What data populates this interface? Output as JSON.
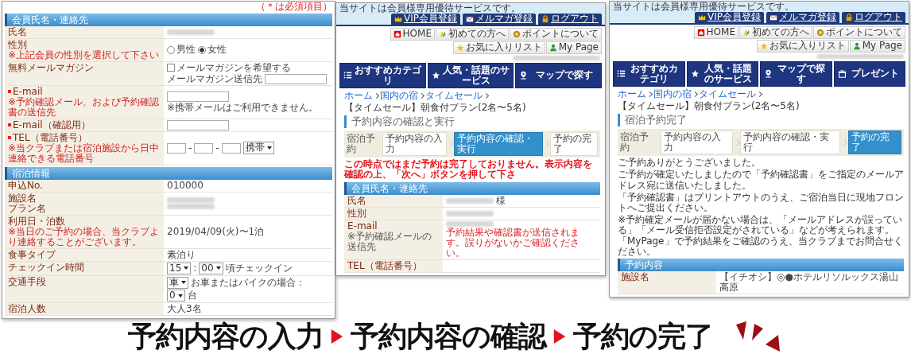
{
  "form_window": {
    "required_note": "（＊は必須項目）",
    "sections": [
      {
        "title": "会員氏名・連絡先",
        "rows": [
          {
            "labels": [
              "氏名"
            ],
            "required": false,
            "notes": [],
            "lines": [
              [
                {
                  "kind": "blur"
                }
              ]
            ]
          },
          {
            "labels": [
              "性別"
            ],
            "required": false,
            "notes": [
              "※上記会員の性別を選択して下さい"
            ],
            "lines": [
              [
                {
                  "kind": "radio",
                  "label": "男性",
                  "selected": false
                },
                {
                  "kind": "radio",
                  "label": "女性",
                  "selected": true
                }
              ]
            ]
          },
          {
            "labels": [
              "無料メールマガジン"
            ],
            "required": false,
            "notes": [],
            "lines": [
              [
                {
                  "kind": "checkbox",
                  "label": "メールマガジンを希望する",
                  "checked": false
                }
              ],
              [
                {
                  "kind": "hint",
                  "value": "メールマガジン送信先"
                },
                {
                  "kind": "field"
                }
              ]
            ]
          },
          {
            "labels": [
              "E-mail"
            ],
            "required": true,
            "notes": [
              "※予約確認メール、および予約確認書の送信先"
            ],
            "lines": [
              [
                {
                  "kind": "field"
                }
              ],
              [
                {
                  "kind": "hint",
                  "value": "※携帯メールはご利用できません。"
                }
              ]
            ]
          },
          {
            "labels": [
              "E-mail（確認用）"
            ],
            "required": true,
            "notes": [],
            "lines": [
              [
                {
                  "kind": "field"
                }
              ]
            ]
          },
          {
            "labels": [
              "TEL（電話番号）"
            ],
            "required": true,
            "notes": [
              "※当クラブまたは宿泊施設から日中連絡できる電話番号"
            ],
            "lines": [
              [
                {
                  "kind": "smallfield"
                },
                {
                  "kind": "text",
                  "value": "-"
                },
                {
                  "kind": "smallfield"
                },
                {
                  "kind": "text",
                  "value": "-"
                },
                {
                  "kind": "smallfield"
                },
                {
                  "kind": "select",
                  "value": "携帯"
                }
              ]
            ]
          }
        ]
      },
      {
        "title": "宿泊情報",
        "rows": [
          {
            "labels": [
              "申込No."
            ],
            "required": false,
            "notes": [],
            "lines": [
              [
                {
                  "kind": "text",
                  "value": "010000"
                }
              ]
            ]
          },
          {
            "labels": [
              "施設名",
              "プラン名"
            ],
            "required": false,
            "notes": [],
            "lines": [
              [
                {
                  "kind": "blur"
                }
              ],
              [
                {
                  "kind": "blur"
                }
              ]
            ]
          },
          {
            "labels": [
              "利用日・泊数"
            ],
            "required": false,
            "notes": [
              "※当日のご予約の場合、当クラブより連絡することがございます。"
            ],
            "lines": [
              [
                {
                  "kind": "text",
                  "value": "2019/04/09(火)〜1泊"
                }
              ]
            ]
          },
          {
            "labels": [
              "食事タイプ"
            ],
            "required": false,
            "notes": [],
            "lines": [
              [
                {
                  "kind": "text",
                  "value": "素泊り"
                }
              ]
            ]
          },
          {
            "labels": [
              "チェックイン時間"
            ],
            "required": false,
            "notes": [],
            "lines": [
              [
                {
                  "kind": "select",
                  "value": "15"
                },
                {
                  "kind": "text",
                  "value": ":"
                },
                {
                  "kind": "select",
                  "value": "00"
                },
                {
                  "kind": "text",
                  "value": "頃チェックイン"
                }
              ]
            ]
          },
          {
            "labels": [
              "交通手段"
            ],
            "required": false,
            "notes": [],
            "lines": [
              [
                {
                  "kind": "select",
                  "value": "車"
                },
                {
                  "kind": "text",
                  "value": "お車またはバイクの場合："
                }
              ],
              [
                {
                  "kind": "select",
                  "value": "0"
                },
                {
                  "kind": "text",
                  "value": "台"
                }
              ]
            ]
          },
          {
            "labels": [
              "宿泊人数"
            ],
            "required": false,
            "notes": [],
            "lines": [
              [
                {
                  "kind": "text",
                  "value": "大人3名"
                }
              ]
            ]
          }
        ]
      }
    ]
  },
  "site_windows": [
    {
      "notice_text": "当サイトは会員様専用優待サービスです。",
      "member_tabs": [
        "VIP会員登録",
        "メルマガ登録",
        "ログアウト"
      ],
      "links": [
        "HOME",
        "初めての方へ",
        "ポイントについて",
        "お気に入りリスト",
        "My Page"
      ],
      "nav": [
        "おすすめカテゴリ",
        "人気・話題のサービス",
        "マップで探す"
      ],
      "breadcrumb": [
        {
          "label": "ホーム",
          "link": true
        },
        {
          "label": "国内の宿",
          "link": true
        },
        {
          "label": "タイムセール",
          "link": true
        },
        {
          "label": "【タイムセール】朝食付プラン(2名〜5名)",
          "link": false
        }
      ],
      "page_title": "予約内容の確認と実行",
      "steps_label": "宿泊予約",
      "steps": [
        {
          "label": "予約内容の入力",
          "selected": false
        },
        {
          "label": "予約内容の確認・実行",
          "selected": true
        },
        {
          "label": "予約の完了",
          "selected": false
        }
      ],
      "warning": "この時点ではまだ予約は完了しておりません。表示内容を確認の上、「次へ」ボタンを押して下さ",
      "sections": [
        {
          "title": "会員氏名・連絡先",
          "rows": [
            {
              "labels": [
                "氏名"
              ],
              "notes": [],
              "lines": [
                [
                  {
                    "kind": "blur"
                  },
                  {
                    "kind": "text",
                    "value": "様"
                  }
                ]
              ]
            },
            {
              "labels": [
                "性別"
              ],
              "notes": [],
              "lines": [
                [
                  {
                    "kind": "blur"
                  }
                ]
              ]
            },
            {
              "labels": [
                "E-mail"
              ],
              "notes": [
                "※予約確認メールの送信先"
              ],
              "lines": [
                [
                  {
                    "kind": "blur"
                  }
                ],
                [
                  {
                    "kind": "warning",
                    "value": "予約結果や確認書が送信されます。誤りがないかご確認ください。"
                  }
                ]
              ]
            },
            {
              "labels": [
                "TEL（電話番号）"
              ],
              "notes": [],
              "lines": []
            }
          ]
        }
      ]
    },
    {
      "notice_text": "当サイトは会員様専用優待サービスです。",
      "member_tabs": [
        "VIP会員登録",
        "メルマガ登録",
        "ログアウト"
      ],
      "links": [
        "HOME",
        "初めての方へ",
        "ポイントについて",
        "お気に入りリスト",
        "My Page"
      ],
      "nav": [
        "おすすめカテゴリ",
        "人気・話題のサービス",
        "マップで探す",
        "プレゼント"
      ],
      "breadcrumb": [
        {
          "label": "ホーム",
          "link": true
        },
        {
          "label": "国内の宿",
          "link": true
        },
        {
          "label": "タイムセール",
          "link": true
        },
        {
          "label": "【タイムセール】朝食付プラン(2名〜5名)",
          "link": false
        }
      ],
      "page_title": "宿泊予約完了",
      "steps_label": "宿泊予約",
      "steps": [
        {
          "label": "予約内容の入力",
          "selected": false
        },
        {
          "label": "予約内容の確認・実行",
          "selected": false
        },
        {
          "label": "予約の完了",
          "selected": true
        }
      ],
      "paragraphs": [
        "ご予約ありがとうございました。",
        "ご予約が確定いたしましたので「予約確認書」をご指定のメールアドレス宛に送信いたしました。",
        "「予約確認書」はプリントアウトのうえ、ご宿泊当日に現地フロントへご提出ください。",
        "※予約確定メールが届かない場合は、「メールアドレスが誤っている」「メール受信拒否設定がされている」などが考えられます。「MyPage」で予約結果をご確認のうえ、当クラブまでお問合せください。"
      ],
      "sections": [
        {
          "title": "予約内容",
          "rows": [
            {
              "labels": [
                "施設名"
              ],
              "notes": [],
              "lines": [
                [
                  {
                    "kind": "text",
                    "value": "【イチオシ】◎●ホテルリソルックス湯山高原"
                  }
                ]
              ]
            }
          ]
        }
      ]
    }
  ],
  "flow_caption": [
    "予約内容の入力",
    "予約内容の確認",
    "予約の完了"
  ]
}
